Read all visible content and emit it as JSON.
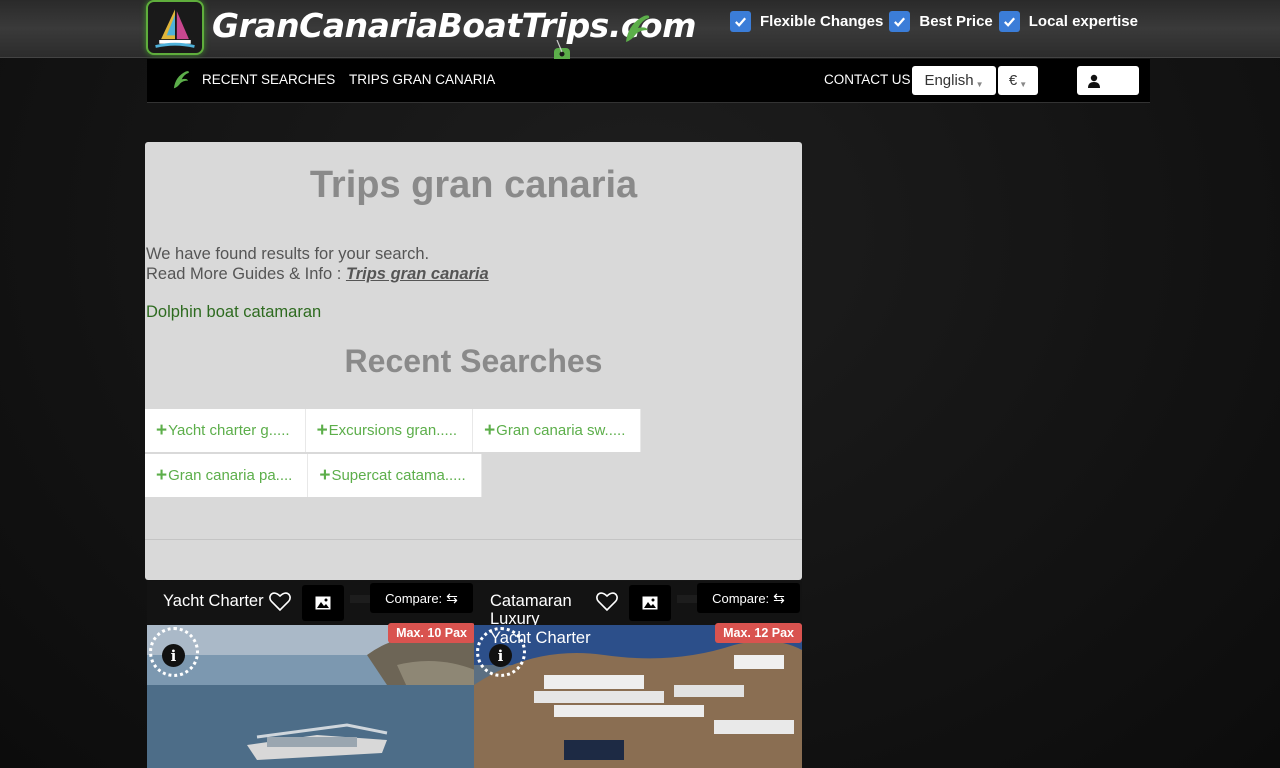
{
  "header": {
    "logo_text": "GranCanariaBoatTrips.com",
    "features": [
      {
        "label": "Flexible Changes"
      },
      {
        "label": "Best Price"
      },
      {
        "label": "Local expertise"
      }
    ]
  },
  "nav": {
    "links": [
      {
        "label": "RECENT SEARCHES"
      },
      {
        "label": "TRIPS GRAN CANARIA"
      },
      {
        "label": "CONTACT US"
      }
    ],
    "language": "English",
    "currency": "€"
  },
  "main": {
    "title": "Trips gran canaria",
    "found_text": "We have found results for your search.",
    "read_more_prefix": "Read More Guides & Info : ",
    "read_more_link": "Trips gran canaria",
    "related_link": "Dolphin boat catamaran",
    "recent_title": "Recent Searches",
    "recent_searches": [
      [
        "Yacht charter g.....",
        "Excursions gran.....",
        "Gran canaria sw....."
      ],
      [
        "Gran canaria pa....",
        "Supercat catama....."
      ]
    ]
  },
  "cards": [
    {
      "title": "Yacht Charter",
      "subtitle": "",
      "compare_label": "Compare:",
      "pax": "Max. 10 Pax"
    },
    {
      "title": "Catamaran Luxury",
      "subtitle": "Yacht Charter",
      "compare_label": "Compare:",
      "pax": "Max. 12 Pax"
    }
  ],
  "colors": {
    "accent_green": "#5cae4a",
    "check_blue": "#3b7dd8",
    "pax_red": "#d9534f"
  }
}
